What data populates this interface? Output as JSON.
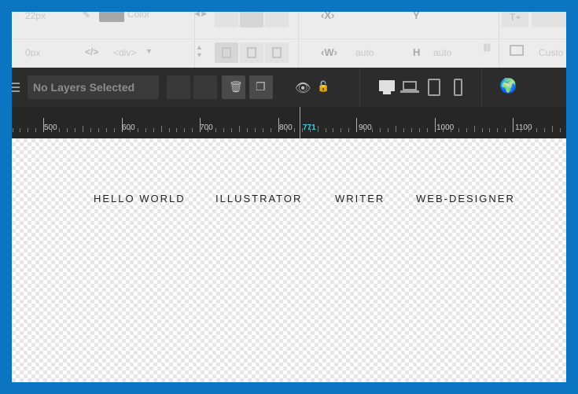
{
  "settings": {
    "font_size_value": "22px",
    "color_label": "Color",
    "x_label": "X",
    "y_label": "Y",
    "padding_value": "0px",
    "tag_value": "<div>",
    "w_label": "W",
    "w_value": "auto",
    "h_label": "H",
    "h_value": "auto",
    "custom_label": "Custo"
  },
  "toolbar": {
    "layer_select_label": "No Layers Selected",
    "icons": [
      "menu-icon",
      "trash-icon",
      "duplicate-icon",
      "eye-icon",
      "unlock-icon",
      "desktop-icon",
      "laptop-icon",
      "tablet-icon",
      "phone-icon",
      "globe-edit-icon"
    ]
  },
  "ruler": {
    "labels": [
      "500",
      "600",
      "700",
      "800",
      "900",
      "1000",
      "1100"
    ],
    "marker_value": "771"
  },
  "canvas": {
    "nav_items": [
      "HELLO WORLD",
      "ILLUSTRATOR",
      "WRITER",
      "WEB-DESIGNER"
    ]
  },
  "colors": {
    "frame_border": "#0b75c2",
    "toolbar_bg": "#2c2c2c",
    "ruler_bg": "#262626",
    "marker": "#3bd0e0"
  }
}
